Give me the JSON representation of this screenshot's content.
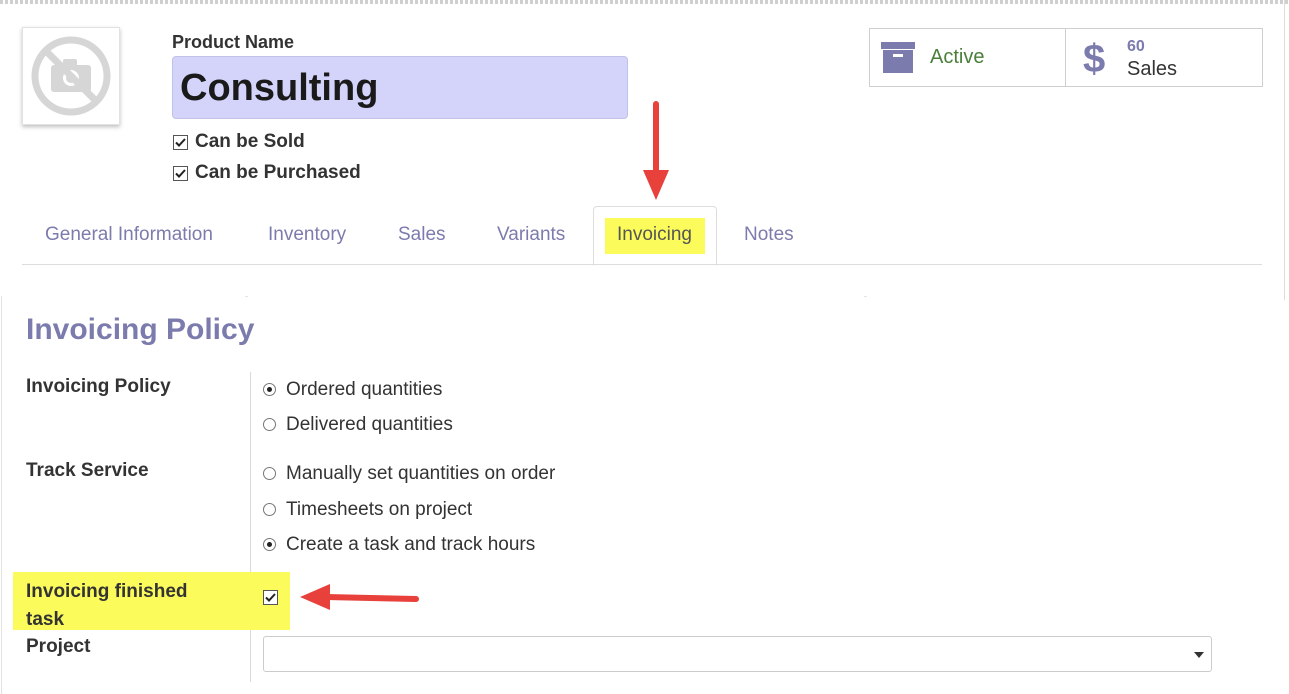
{
  "product": {
    "name_label": "Product Name",
    "name_value": "Consulting",
    "can_be_sold": {
      "label": "Can be Sold",
      "checked": true
    },
    "can_be_purchased": {
      "label": "Can be Purchased",
      "checked": true
    },
    "photo_icon": "no-image-camera-icon"
  },
  "smart_buttons": {
    "active": {
      "label": "Active",
      "icon": "archive-box-icon",
      "color": "#4a7f3a"
    },
    "sales": {
      "count": "60",
      "label": "Sales",
      "icon": "dollar-icon"
    }
  },
  "tabs": [
    {
      "label": "General Information",
      "active": false
    },
    {
      "label": "Inventory",
      "active": false
    },
    {
      "label": "Sales",
      "active": false
    },
    {
      "label": "Variants",
      "active": false
    },
    {
      "label": "Invoicing",
      "active": true
    },
    {
      "label": "Notes",
      "active": false
    }
  ],
  "invoicing": {
    "section_title": "Invoicing Policy",
    "policy_label": "Invoicing Policy",
    "policy_options": [
      {
        "label": "Ordered quantities",
        "selected": true
      },
      {
        "label": "Delivered quantities",
        "selected": false
      }
    ],
    "track_label": "Track Service",
    "track_options": [
      {
        "label": "Manually set quantities on order",
        "selected": false
      },
      {
        "label": "Timesheets on project",
        "selected": false
      },
      {
        "label": "Create a task and track hours",
        "selected": true
      }
    ],
    "finished_task_label": "Invoicing finished task",
    "finished_task_checked": true,
    "project_label": "Project",
    "project_value": ""
  },
  "colors": {
    "accent": "#7c7bad",
    "highlight": "#fbfb5c",
    "name_field_bg": "#d4d4fb",
    "annotation_arrow": "#e8403a"
  }
}
